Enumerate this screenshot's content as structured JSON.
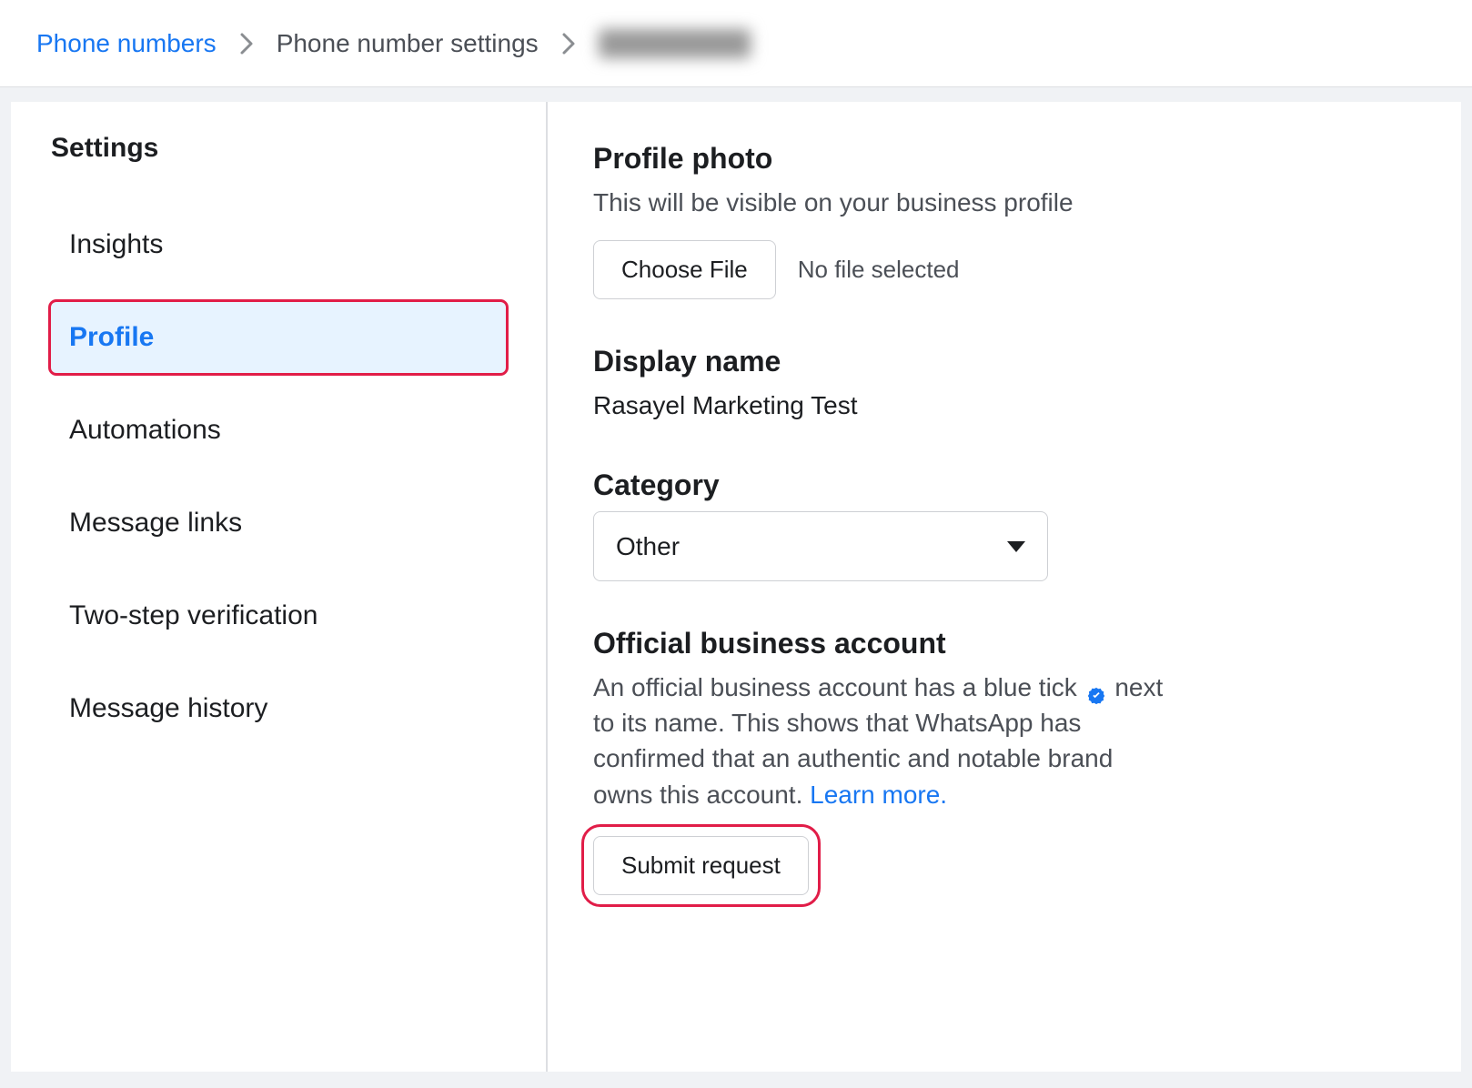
{
  "breadcrumb": {
    "root": "Phone numbers",
    "mid": "Phone number settings"
  },
  "sidebar": {
    "title": "Settings",
    "items": [
      {
        "label": "Insights",
        "active": false
      },
      {
        "label": "Profile",
        "active": true
      },
      {
        "label": "Automations",
        "active": false
      },
      {
        "label": "Message links",
        "active": false
      },
      {
        "label": "Two-step verification",
        "active": false
      },
      {
        "label": "Message history",
        "active": false
      }
    ]
  },
  "profile_photo": {
    "heading": "Profile photo",
    "sub": "This will be visible on your business profile",
    "choose_label": "Choose File",
    "no_file_label": "No file selected"
  },
  "display_name": {
    "heading": "Display name",
    "value": "Rasayel Marketing Test"
  },
  "category": {
    "heading": "Category",
    "selected": "Other"
  },
  "official_business": {
    "heading": "Official business account",
    "text_before_tick": "An official business account has a blue tick ",
    "text_after_tick": " next to its name. This shows that WhatsApp has confirmed that an authentic and notable brand owns this account. ",
    "learn_more": "Learn more.",
    "submit_label": "Submit request"
  }
}
